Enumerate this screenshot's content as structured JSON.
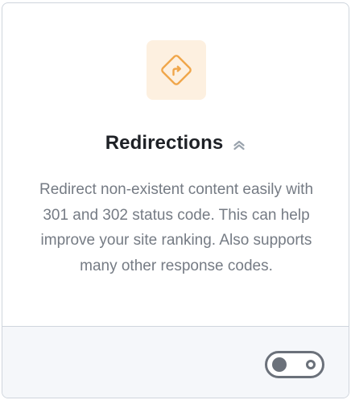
{
  "module": {
    "icon": "redirect-sign-icon",
    "title": "Redirections",
    "pro_badge_icon": "double-chevron-up-icon",
    "description": "Redirect non-existent content easily with 301 and 302 status code. This can help improve your site ranking. Also supports many other response codes.",
    "toggle": {
      "state": "off"
    }
  },
  "colors": {
    "icon_accent": "#f0a64a",
    "icon_background": "#fdf0e0",
    "title": "#1e2126",
    "description": "#757b84",
    "footer_background": "#f5f7fa",
    "toggle": "#6b717a",
    "border": "#cfd5dd"
  }
}
